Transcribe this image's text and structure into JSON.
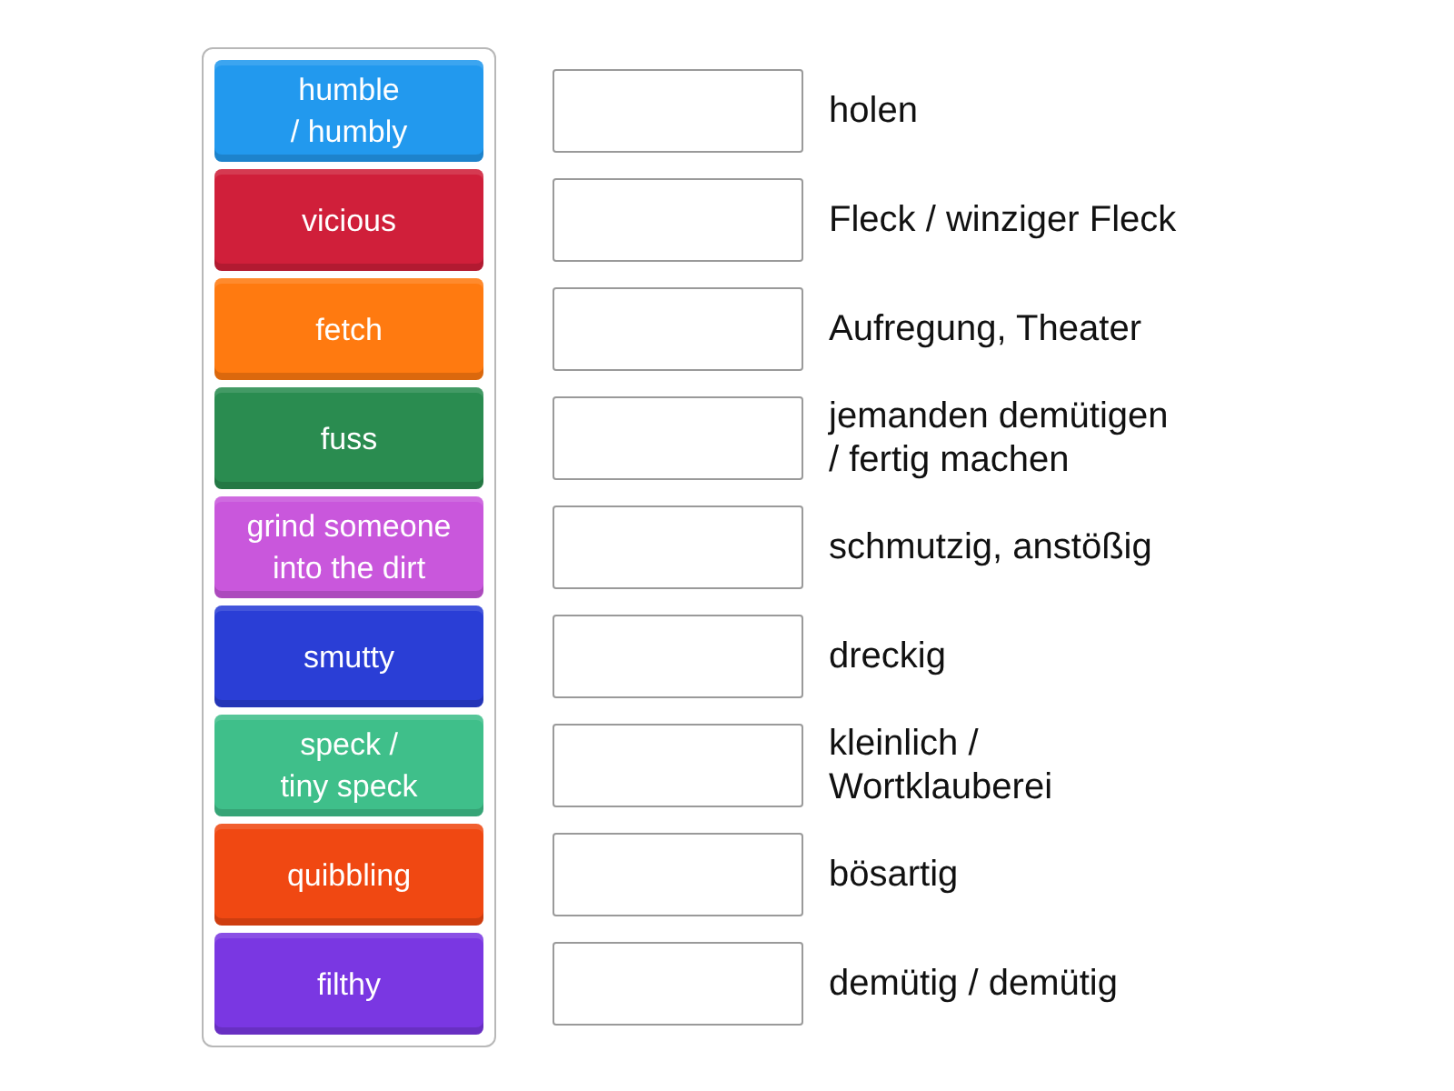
{
  "tiles": [
    {
      "label": "humble\n/ humbly",
      "color": "#2299ee"
    },
    {
      "label": "vicious",
      "color": "#d01f3a"
    },
    {
      "label": "fetch",
      "color": "#ff7a10"
    },
    {
      "label": "fuss",
      "color": "#2a8c50"
    },
    {
      "label": "grind someone\ninto the dirt",
      "color": "#c957dc"
    },
    {
      "label": "smutty",
      "color": "#2a3ed6"
    },
    {
      "label": "speck /\ntiny speck",
      "color": "#3fbf8a"
    },
    {
      "label": "quibbling",
      "color": "#f04812"
    },
    {
      "label": "filthy",
      "color": "#7a37e2"
    }
  ],
  "answers": [
    {
      "text": "holen"
    },
    {
      "text": "Fleck / winziger Fleck"
    },
    {
      "text": "Aufregung, Theater"
    },
    {
      "text": "jemanden demütigen\n/ fertig machen"
    },
    {
      "text": "schmutzig, anstößig"
    },
    {
      "text": "dreckig"
    },
    {
      "text": "kleinlich /\nWortklauberei"
    },
    {
      "text": "bösartig"
    },
    {
      "text": "demütig / demütig"
    }
  ]
}
